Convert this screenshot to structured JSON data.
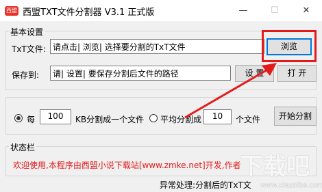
{
  "window": {
    "icon_text": "西盟",
    "title": "西盟TXT文件分割器 V3.1 正式版",
    "minimize": "—",
    "maximize": "☐",
    "close": "✕"
  },
  "basic_settings": {
    "caption": "基本设置",
    "txt_label": "TxT文件:",
    "txt_value": "请点击| 浏览| 选择要分割的TxT文件",
    "browse_label": "浏览",
    "save_label": "保存到:",
    "save_value": "请| 设置| 要保存分割后文件的路径",
    "settings_label": "设 置",
    "open_label": "打 开"
  },
  "split_options": {
    "option1_prefix": "每",
    "size_value": "100",
    "option1_suffix": "KB分割成一个文件",
    "option2_prefix": "平均分割成",
    "count_value": "10",
    "option2_suffix": "个文件",
    "selected": "by_size",
    "start_label": "开始分割"
  },
  "status": {
    "caption": "状态栏",
    "message": "欢迎使用,本程序由西盟小说下载站[www.zmke.net]开发,作者",
    "bottom": "异常处理:分割后的TxT文"
  },
  "watermark": {
    "logo": "下载吧",
    "url": "www.xiazaiba.com"
  },
  "colors": {
    "highlight": "#e41a1a",
    "status_text": "#e41a1a",
    "focus_border": "#0078d7"
  }
}
